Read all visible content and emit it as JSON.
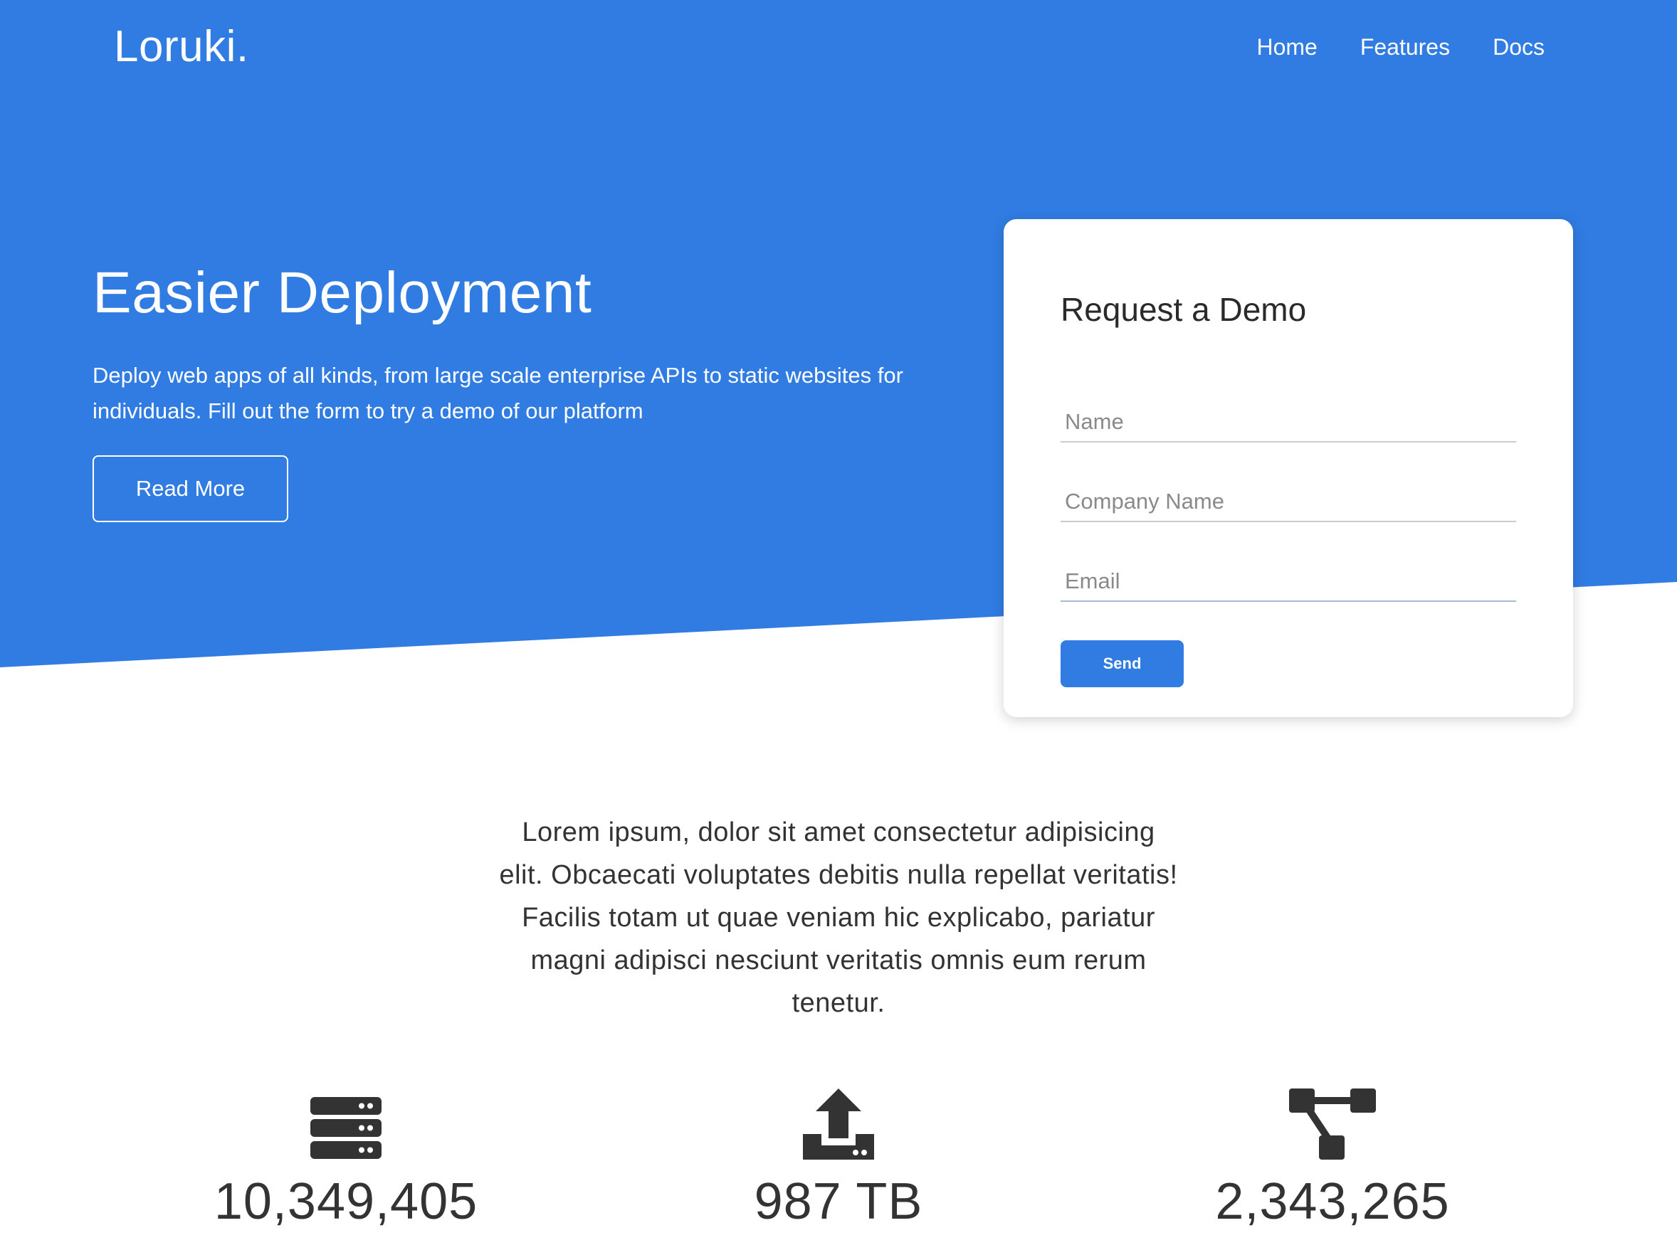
{
  "brand": {
    "logo": "Loruki."
  },
  "nav": {
    "items": [
      "Home",
      "Features",
      "Docs"
    ]
  },
  "hero": {
    "title": "Easier Deployment",
    "subtitle": "Deploy web apps of all kinds, from large scale enterprise APIs to static websites for individuals. Fill out the form to try a demo of our platform",
    "button_label": "Read More"
  },
  "demo_form": {
    "title": "Request a Demo",
    "name_placeholder": "Name",
    "company_placeholder": "Company Name",
    "email_placeholder": "Email",
    "name_value": "",
    "company_value": "",
    "email_value": "",
    "send_label": "Send"
  },
  "intro": {
    "text": "Lorem ipsum, dolor sit amet consectetur adipisicing elit. Obcaecati voluptates debitis nulla repellat veritatis! Facilis totam ut quae veniam hic explicabo, pariatur magni adipisci nesciunt veritatis omnis eum rerum tenetur."
  },
  "stats": [
    {
      "icon": "server-icon",
      "value": "10,349,405"
    },
    {
      "icon": "upload-icon",
      "value": "987 TB"
    },
    {
      "icon": "project-diagram-icon",
      "value": "2,343,265"
    }
  ],
  "colors": {
    "primary": "#307ce3",
    "text_dark": "#333333",
    "white": "#ffffff"
  }
}
